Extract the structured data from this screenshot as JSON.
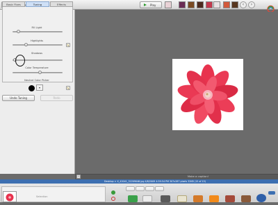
{
  "toolbar": {
    "back_label": "Back to Library",
    "play_label": "Play"
  },
  "panel": {
    "tabs": [
      "Basic Fixes",
      "Tuning",
      "Effects"
    ],
    "sliders": {
      "fill_light": "Fill Light",
      "highlights": "Highlights",
      "shadows": "Shadows",
      "color_temperature": "Color Temperature"
    },
    "slider_values": {
      "fill_light": 0.12,
      "highlights": 0.28,
      "shadows": 0.05,
      "color_temperature": 0.55
    },
    "neutral_color_picker": "Neutral Color Picker",
    "undo_label": "Undo Tuning",
    "redo_label": "Redo"
  },
  "caption": {
    "placeholder": "Make a caption!"
  },
  "status": {
    "text": "Desktop > X_42041_32209046.jpg    4/8/2009 4:59:54 PM    307x287 pixels    32KB    (15 of 15)"
  },
  "tray": {
    "label": "Selection"
  },
  "icons": {
    "back": "arrow-left-icon",
    "play": "play-icon",
    "prev": "chevron-left-icon",
    "next": "chevron-right-icon",
    "eyedropper": "eyedropper-icon",
    "logo": "picasa-logo-icon"
  },
  "colors": {
    "status_bar": "#3d6fb1",
    "canvas": "#6b6b6b",
    "active_tab": "#cfe0f6",
    "picked_color": "#000000"
  }
}
